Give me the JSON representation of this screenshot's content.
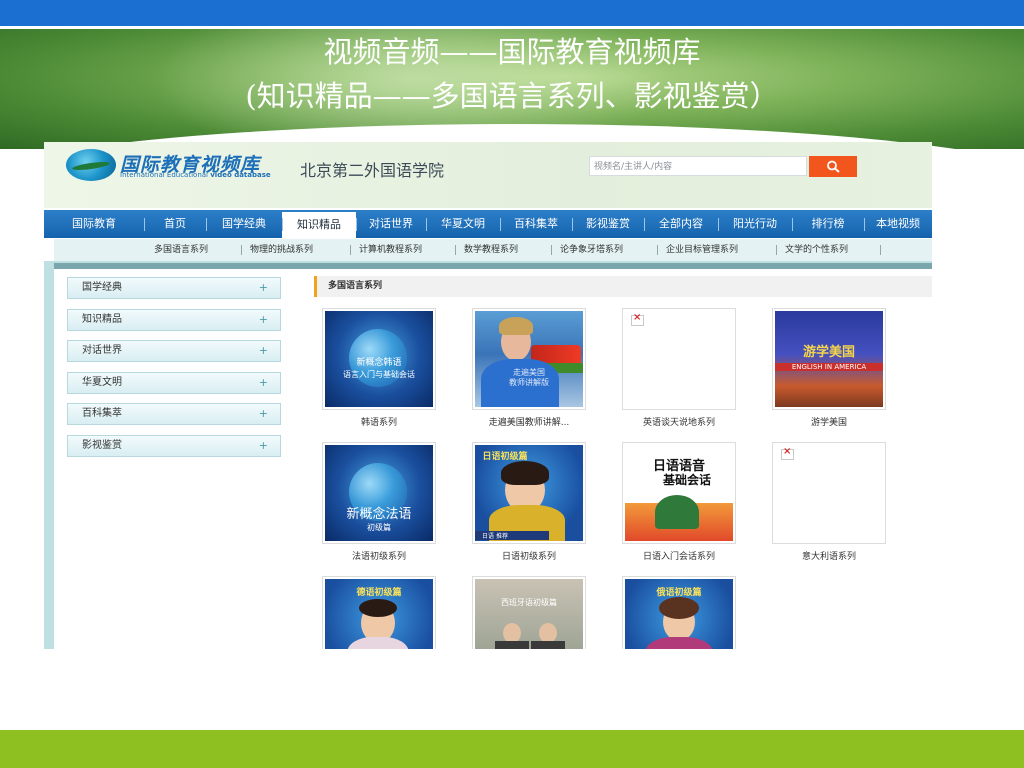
{
  "slide": {
    "title_line1": "视频音频——国际教育视频库",
    "title_line2": "(知识精品——多国语言系列、影视鉴赏）"
  },
  "site": {
    "logo_cn": "国际教育视频库",
    "logo_en": "International Educational",
    "logo_en_bold": "video database",
    "school_name": "北京第二外国语学院",
    "search_placeholder": "视频名/主讲人/内容"
  },
  "nav": [
    "国际教育",
    "首页",
    "国学经典",
    "知识精品",
    "对话世界",
    "华夏文明",
    "百科集萃",
    "影视鉴赏",
    "全部内容",
    "阳光行动",
    "排行榜",
    "本地视频"
  ],
  "nav_active": "知识精品",
  "subnav": [
    "多国语言系列",
    "物理的挑战系列",
    "计算机教程系列",
    "数学教程系列",
    "论争象牙塔系列",
    "企业目标管理系列",
    "文学的个性系列"
  ],
  "sidebar": [
    "国学经典",
    "知识精品",
    "对话世界",
    "华夏文明",
    "百科集萃",
    "影视鉴赏"
  ],
  "sidebar_expand": "+",
  "section_title": "多国语言系列",
  "videos": [
    {
      "caption": "韩语系列",
      "thumb_line1": "新概念韩语",
      "thumb_line2": "语言入门与基础会话"
    },
    {
      "caption": "走遍美国教师讲解...",
      "thumb_line1": "走遍美国",
      "thumb_line2": "教师讲解版"
    },
    {
      "caption": "英语谈天说地系列"
    },
    {
      "caption": "游学美国",
      "thumb_line1": "游学美国",
      "thumb_line2": "ENGLISH IN AMERICA"
    },
    {
      "caption": "法语初级系列",
      "thumb_line1": "新概念法语",
      "thumb_line2": "初级篇"
    },
    {
      "caption": "日语初级系列",
      "thumb_line1": "日语初级篇",
      "thumb_line2": "日语 推荐"
    },
    {
      "caption": "日语入门会话系列",
      "thumb_line1": "日语语音",
      "thumb_line2": "基础会话"
    },
    {
      "caption": "意大利语系列"
    },
    {
      "caption": "",
      "thumb_line1": "德语初级篇"
    },
    {
      "caption": "",
      "thumb_line1": "西班牙语初级篇"
    },
    {
      "caption": "",
      "thumb_line1": "俄语初级篇"
    }
  ]
}
